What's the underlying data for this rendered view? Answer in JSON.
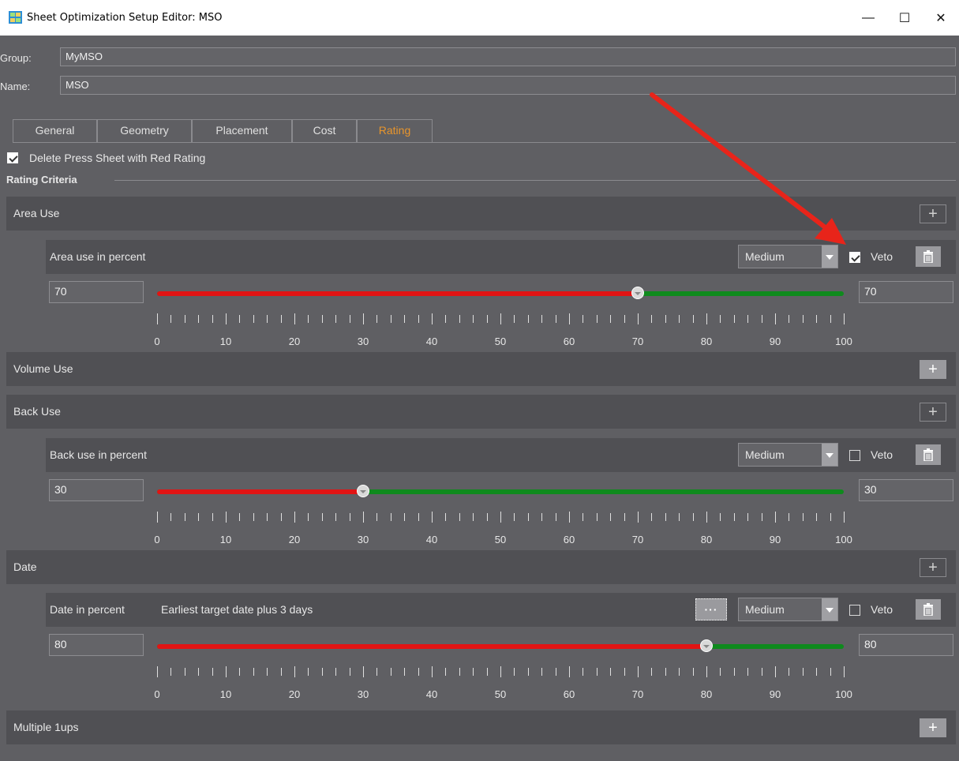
{
  "window": {
    "title": "Sheet Optimization Setup Editor: MSO",
    "minimize": "—",
    "maximize": "☐",
    "close": "✕"
  },
  "header": {
    "group_label": "Group:",
    "group_value": "MyMSO",
    "name_label": "Name:",
    "name_value": "MSO"
  },
  "tabs": [
    {
      "label": "General",
      "active": false
    },
    {
      "label": "Geometry",
      "active": false
    },
    {
      "label": "Placement",
      "active": false
    },
    {
      "label": "Cost",
      "active": false
    },
    {
      "label": "Rating",
      "active": true
    }
  ],
  "delete_red": {
    "label": "Delete Press Sheet with Red Rating",
    "checked": true
  },
  "rating_criteria_label": "Rating Criteria",
  "sections": {
    "area_use": "Area Use",
    "volume_use": "Volume Use",
    "back_use": "Back Use",
    "date": "Date",
    "multiple": "Multiple 1ups"
  },
  "criteria": {
    "area": {
      "title": "Area use in percent",
      "level": "Medium",
      "veto_label": "Veto",
      "veto": true,
      "min_value": "70",
      "max_value": "70",
      "fraction": 0.7
    },
    "back": {
      "title": "Back use in percent",
      "level": "Medium",
      "veto_label": "Veto",
      "veto": false,
      "min_value": "30",
      "max_value": "30",
      "fraction": 0.3
    },
    "date": {
      "title": "Date in percent",
      "description": "Earliest target date plus 3 days",
      "level": "Medium",
      "veto_label": "Veto",
      "veto": false,
      "min_value": "80",
      "max_value": "80",
      "fraction": 0.8,
      "more_label": "···"
    }
  },
  "scale_labels": [
    "0",
    "10",
    "20",
    "30",
    "40",
    "50",
    "60",
    "70",
    "80",
    "90",
    "100"
  ],
  "colors": {
    "accent_tab": "#e8952c",
    "slider_low": "#e11414",
    "slider_high": "#0f8a1d",
    "annotation_arrow": "#e8241a"
  },
  "icons": {
    "plus": "+",
    "trash": "trash-icon",
    "app": "app-icon"
  }
}
